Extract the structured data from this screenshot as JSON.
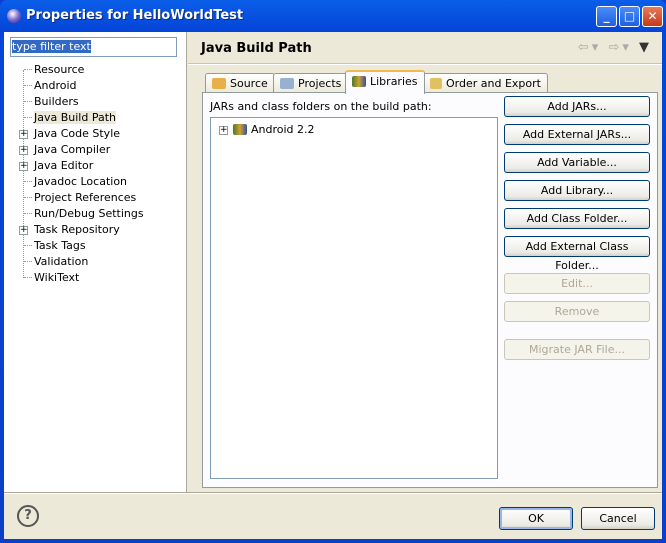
{
  "window": {
    "title": "Properties for HelloWorldTest",
    "icon": "eclipse-icon"
  },
  "filter": {
    "value": "type filter text"
  },
  "tree": [
    {
      "label": "Resource",
      "expandable": false
    },
    {
      "label": "Android",
      "expandable": false
    },
    {
      "label": "Builders",
      "expandable": false
    },
    {
      "label": "Java Build Path",
      "expandable": false,
      "selected": true
    },
    {
      "label": "Java Code Style",
      "expandable": true
    },
    {
      "label": "Java Compiler",
      "expandable": true
    },
    {
      "label": "Java Editor",
      "expandable": true
    },
    {
      "label": "Javadoc Location",
      "expandable": false
    },
    {
      "label": "Project References",
      "expandable": false
    },
    {
      "label": "Run/Debug Settings",
      "expandable": false
    },
    {
      "label": "Task Repository",
      "expandable": true
    },
    {
      "label": "Task Tags",
      "expandable": false
    },
    {
      "label": "Validation",
      "expandable": false
    },
    {
      "label": "WikiText",
      "expandable": false
    }
  ],
  "page": {
    "title": "Java Build Path"
  },
  "tabs": [
    {
      "label": "Source"
    },
    {
      "label": "Projects"
    },
    {
      "label": "Libraries",
      "active": true
    },
    {
      "label": "Order and Export"
    }
  ],
  "libraries": {
    "label": "JARs and class folders on the build path:",
    "items": [
      {
        "label": "Android 2.2"
      }
    ]
  },
  "buttons": [
    {
      "label": "Add JARs...",
      "enabled": true
    },
    {
      "label": "Add External JARs...",
      "enabled": true
    },
    {
      "label": "Add Variable...",
      "enabled": true
    },
    {
      "label": "Add Library...",
      "enabled": true
    },
    {
      "label": "Add Class Folder...",
      "enabled": true
    },
    {
      "label": "Add External Class Folder...",
      "enabled": true
    },
    {
      "label": "Edit...",
      "enabled": false
    },
    {
      "label": "Remove",
      "enabled": false
    },
    {
      "label": "Migrate JAR File...",
      "enabled": false
    }
  ],
  "dialog": {
    "ok": "OK",
    "cancel": "Cancel",
    "help": "?"
  }
}
